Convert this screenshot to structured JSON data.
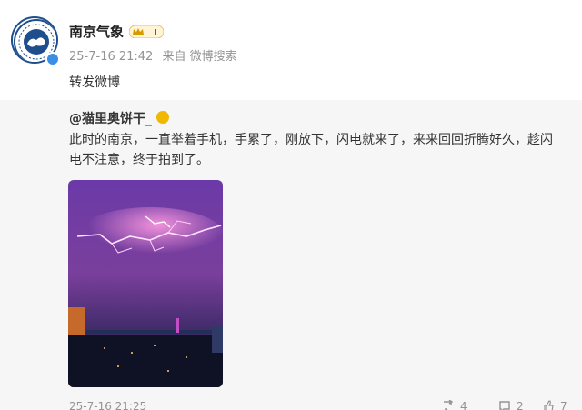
{
  "post": {
    "author": "南京气象",
    "time": "25-7-16 21:42",
    "source": "来自 微博搜索",
    "text": "转发微博"
  },
  "retweet": {
    "author": "@猫里奥饼干_",
    "text": "此时的南京，一直举着手机，手累了，刚放下，闪电就来了，来来回回折腾好久，趁闪电不注意，终于拍到了。",
    "time": "25-7-16 21:25",
    "actions": {
      "repost": "4",
      "comment": "2",
      "like": "7"
    }
  },
  "colors": {
    "accent": "#f0b800",
    "link": "#3a8ee6",
    "muted": "#939393"
  }
}
